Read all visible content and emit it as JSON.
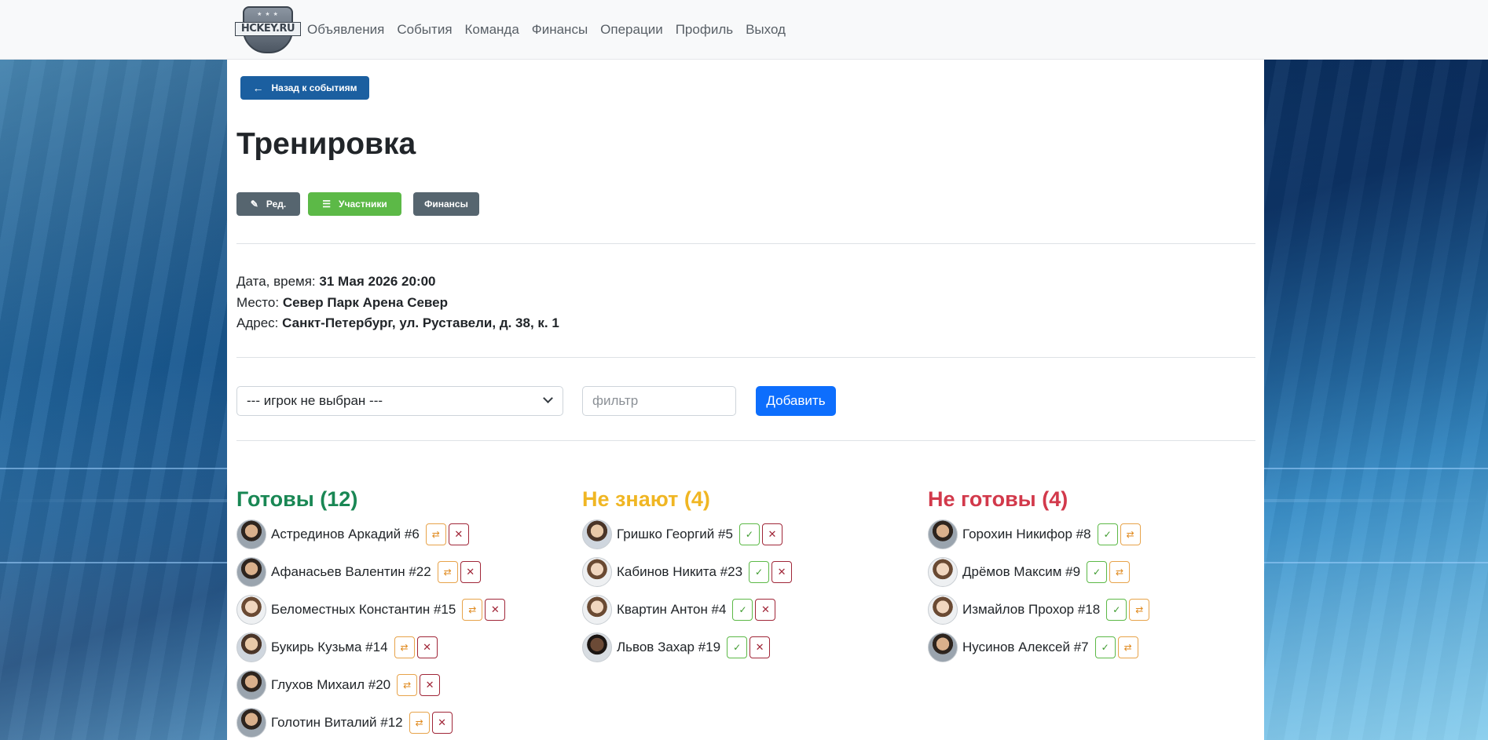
{
  "nav": {
    "logo_text": "HCKEY.RU",
    "links": [
      "Объявления",
      "События",
      "Команда",
      "Финансы",
      "Операции",
      "Профиль",
      "Выход"
    ]
  },
  "back_button": {
    "icon": "arrow-left-icon",
    "label": "Назад к событиям"
  },
  "title": "Тренировка",
  "actions": {
    "edit_label": "Ред.",
    "participants_label": "Участники",
    "finance_label": "Финансы"
  },
  "info": {
    "date_label": "Дата, время:",
    "date_value": "31 Мая 2026 20:00",
    "place_label": "Место:",
    "place_value": "Север Парк Арена Север",
    "address_label": "Адрес:",
    "address_value": "Санкт-Петербург, ул. Руставели, д. 38, к. 1"
  },
  "controls": {
    "select_value": "--- игрок не выбран ---",
    "filter_placeholder": "фильтр",
    "add_label": "Добавить"
  },
  "columns": {
    "ready": {
      "title": "Готовы (12)",
      "players": [
        "Астрединов Аркадий #6",
        "Афанасьев Валентин #22",
        "Беломестных Константин #15",
        "Букирь Кузьма #14",
        "Глухов Михаил #20",
        "Голотин Виталий #12"
      ]
    },
    "unknown": {
      "title": "Не знают (4)",
      "players": [
        "Гришко Георгий #5",
        "Кабинов Никита #23",
        "Квартин Антон #4",
        "Львов Захар #19"
      ]
    },
    "not_ready": {
      "title": "Не готовы (4)",
      "players": [
        "Горохин Никифор #8",
        "Дрёмов Максим #9",
        "Измайлов Прохор #18",
        "Нусинов Алексей #7"
      ]
    }
  },
  "colors": {
    "ready": "#198754",
    "unknown": "#f0b623",
    "not_ready": "#d2394b",
    "primary": "#0d6efd"
  }
}
